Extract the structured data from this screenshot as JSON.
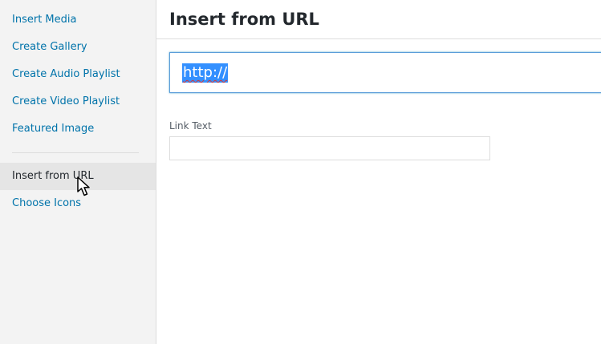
{
  "sidebar": {
    "items": [
      {
        "label": "Insert Media"
      },
      {
        "label": "Create Gallery"
      },
      {
        "label": "Create Audio Playlist"
      },
      {
        "label": "Create Video Playlist"
      },
      {
        "label": "Featured Image"
      },
      {
        "label": "Insert from URL"
      },
      {
        "label": "Choose Icons"
      }
    ],
    "active_item": "Insert from URL"
  },
  "main": {
    "title": "Insert from URL",
    "url_field": {
      "value": "http://"
    },
    "link_text_field": {
      "label": "Link Text",
      "value": ""
    }
  },
  "colors": {
    "link": "#0073aa",
    "active_background": "#e5e5e5",
    "sidebar_background": "#f3f3f3",
    "focus_border": "#5b9dd9",
    "selection": "#3390ff"
  },
  "icons": {
    "cursor": "mouse-pointer-icon"
  }
}
